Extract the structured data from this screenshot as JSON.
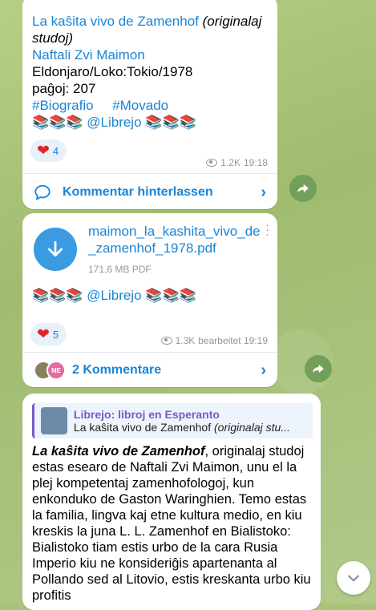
{
  "messages": [
    {
      "title_link": "La kaŝita vivo de Zamenhof",
      "title_italic": "(originalaj",
      "title_italic2": "studoj)",
      "author": "Naftali Zvi Maimon",
      "publish_line": "Eldonjaro/Loko:Tokio/1978",
      "pages": "paĝoj: 207",
      "tag1": "#Biografio",
      "tag2": "#Movado",
      "signature_books_left": "📚📚📚",
      "signature_handle": "@Librejo",
      "signature_books_right": "📚📚📚",
      "reaction": {
        "emoji": "❤",
        "count": "4"
      },
      "views": "1.2K",
      "time": "19:18",
      "comment_label": "Kommentar hinterlassen"
    },
    {
      "file_name": "maimon_la_kashita_vivo_de_zamenhof_1978.pdf",
      "file_size": "171,6 MB PDF",
      "signature_books_left": "📚📚📚",
      "signature_handle": "@Librejo",
      "signature_books_right": "📚📚📚",
      "reaction": {
        "emoji": "❤",
        "count": "5"
      },
      "views": "1.3K",
      "edited_time": "bearbeitet 19:19",
      "avatar_initials": "ME",
      "comments_label": "2 Kommentare"
    },
    {
      "reply_title": "Librejo: libroj en Esperanto",
      "reply_sub_plain": "La kaŝita vivo de Zamenhof ",
      "reply_sub_italic": "(originalaj stu...",
      "body_bold_italic": "La kaŝita vivo de Zamenhof",
      "body_rest": ", originalaj studoj estas esearo de Naftali Zvi Maimon, unu el la plej kompetentaj zamenhofologoj, kun enkonduko de Gaston Waringhien. Temo estas la familia, lingva kaj etne kultura medio, en kiu kreskis la juna L. L. Zamenhof en Bialistoko: Bialistoko tiam estis urbo de la cara Rusia Imperio kiu ne konsideriĝis apartenanta al Pollando sed al Litovio, estis kreskanta urbo kiu profitis"
    }
  ]
}
